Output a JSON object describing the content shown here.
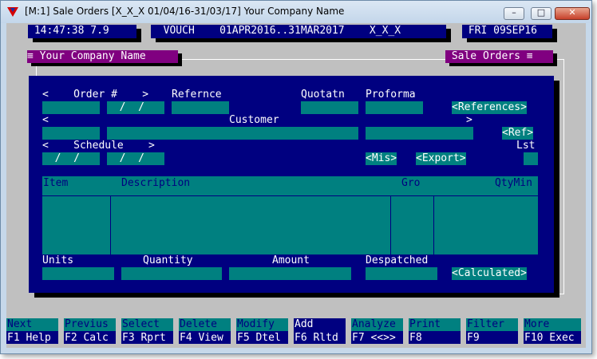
{
  "window": {
    "title": "[M:1] Sale Orders  [X_X_X  01/04/16-31/03/17]  Your Company Name",
    "minimize_glyph": "–",
    "maximize_glyph": "□",
    "close_glyph": "✕"
  },
  "status": {
    "clock": " 14:47:38 7.9",
    "voucher": "  VOUCH    01APR2016..31MAR2017    X_X_X ",
    "date": " FRI 09SEP16"
  },
  "headers": {
    "company": "≡ Your Company Name ",
    "module": " Sale Orders ≡"
  },
  "form": {
    "order_label": "<    Order #    >",
    "reference_label": "Refernce",
    "quotation_label": "Quotatn",
    "proforma_label": "Proforma",
    "order_date": "  /  /",
    "references_button": "<References>",
    "customer_left": "<",
    "customer_label": "Customer",
    "customer_right": ">",
    "ref_button": "<Ref>",
    "schedule_label": "<    Schedule    >",
    "lst_label": "Lst",
    "schedule_from": "  /  /",
    "schedule_to": "  /  /",
    "mis_button": "<Mis>",
    "export_button": "<Export>",
    "units_label": "Units",
    "quantity_label": "Quantity",
    "amount_label": "Amount",
    "despatched_label": "Despatched",
    "calculated_button": "<Calculated>"
  },
  "grid": {
    "columns": [
      "Item",
      "Description",
      "Gro",
      "QtyMin"
    ]
  },
  "function_keys": [
    {
      "action": "Next",
      "key": "F1 Help"
    },
    {
      "action": "Previus",
      "key": "F2 Calc"
    },
    {
      "action": "Select",
      "key": "F3 Rprt"
    },
    {
      "action": "Delete",
      "key": "F4 View"
    },
    {
      "action": "Modify",
      "key": "F5 Dtel"
    },
    {
      "action": "Add",
      "key": "F6 Rltd"
    },
    {
      "action": "Analyze",
      "key": "F7 <<>>"
    },
    {
      "action": "Print",
      "key": "F8"
    },
    {
      "action": "Filter",
      "key": "F9"
    },
    {
      "action": "More",
      "key": "F10 Exec"
    }
  ],
  "colors": {
    "navy": "#000080",
    "teal": "#008080",
    "purple": "#800080",
    "background": "#c0c0c0"
  }
}
